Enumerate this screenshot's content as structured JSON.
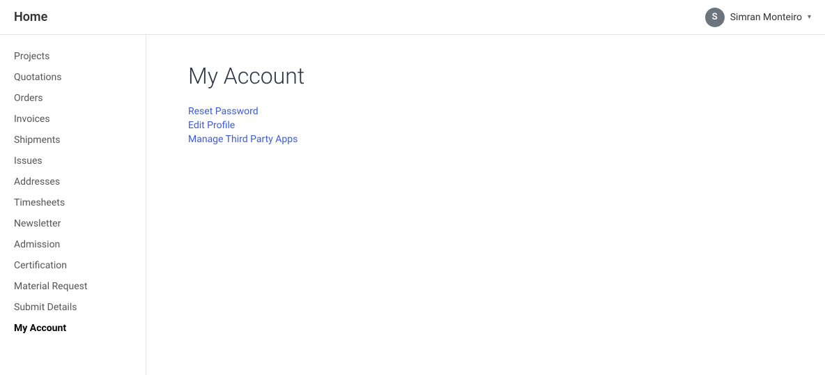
{
  "navbar": {
    "brand": "Home",
    "user": {
      "initial": "S",
      "name": "Simran Monteiro"
    }
  },
  "sidebar": {
    "items": [
      {
        "label": "Projects",
        "active": false
      },
      {
        "label": "Quotations",
        "active": false
      },
      {
        "label": "Orders",
        "active": false
      },
      {
        "label": "Invoices",
        "active": false
      },
      {
        "label": "Shipments",
        "active": false
      },
      {
        "label": "Issues",
        "active": false
      },
      {
        "label": "Addresses",
        "active": false
      },
      {
        "label": "Timesheets",
        "active": false
      },
      {
        "label": "Newsletter",
        "active": false
      },
      {
        "label": "Admission",
        "active": false
      },
      {
        "label": "Certification",
        "active": false
      },
      {
        "label": "Material Request",
        "active": false
      },
      {
        "label": "Submit Details",
        "active": false
      },
      {
        "label": "My Account",
        "active": true
      }
    ]
  },
  "main": {
    "title": "My Account",
    "links": [
      {
        "label": "Reset Password"
      },
      {
        "label": "Edit Profile"
      },
      {
        "label": "Manage Third Party Apps"
      }
    ]
  }
}
